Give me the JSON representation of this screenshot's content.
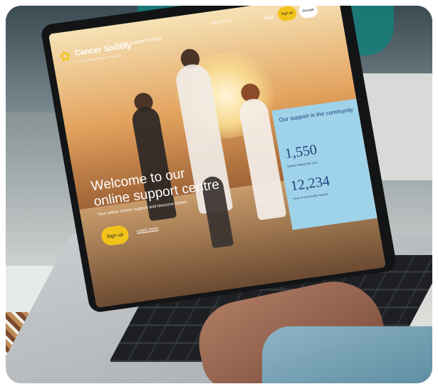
{
  "site": {
    "brand_name": "Cancer Society",
    "tagline": "Te Kāhui Matepukupuku o Aotearoa",
    "section_title": "Online support centre",
    "phone": "0800 226 237",
    "nav": {
      "login_label": "Log in",
      "signup_label": "Sign up",
      "donate_label": "Donate"
    }
  },
  "hero": {
    "title_line1": "Welcome to our",
    "title_line2": "online support centre",
    "subtitle": "Your online cancer support and resource centre",
    "signup_label": "Sign up",
    "learn_more_label": "Learn more"
  },
  "stats_panel": {
    "title": "Our support in the community",
    "stats": [
      {
        "value": "1,550",
        "label": "families helped this year"
      },
      {
        "value": "12,234",
        "label": "hours of community support"
      }
    ]
  },
  "colors": {
    "accent_yellow": "#f2c41b",
    "stats_panel_blue": "#9fd3ea",
    "stats_text_navy": "#1f3f7a"
  },
  "icons": {
    "logo": "daffodil-icon"
  }
}
